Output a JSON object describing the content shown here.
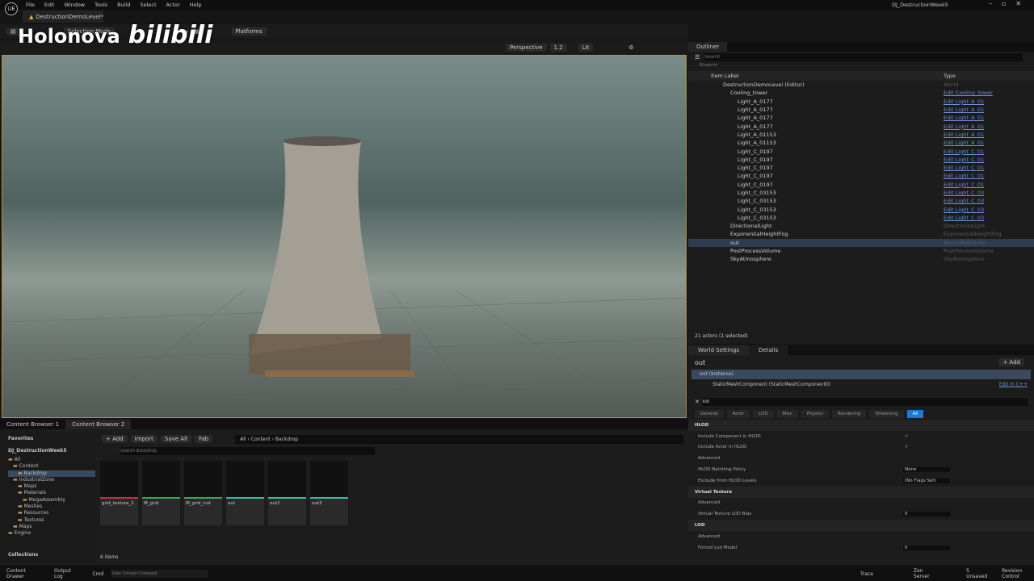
{
  "app": {
    "logo": "UE",
    "window_title": "DJ_DestructionWeek5",
    "menu": [
      "File",
      "Edit",
      "Window",
      "Tools",
      "Build",
      "Select",
      "Actor",
      "Help"
    ],
    "level_tab": "DestructionDemoLevel*"
  },
  "watermark": {
    "text": "Holonova",
    "brand": "bilibili"
  },
  "toolbar": {
    "mode": "Selection Mode",
    "platforms": "Platforms"
  },
  "viewport_toolbar": {
    "perspective": "Perspective",
    "camera_speed": "1.2",
    "view_mode": "Lit"
  },
  "outliner": {
    "tab": "Outliner",
    "search_placeholder": "Search",
    "filter_chip": "Blueprint",
    "col_label": "Item Label",
    "col_type": "Type",
    "items": [
      {
        "label": "DestructionDemoLevel (Editor)",
        "type": "World",
        "indent": 1,
        "link": false
      },
      {
        "label": "Cooling_tower",
        "type": "Edit Cooling_tower",
        "indent": 2,
        "link": true
      },
      {
        "label": "Light_A_0177",
        "type": "Edit Light_A_01",
        "indent": 3,
        "link": true
      },
      {
        "label": "Light_A_0177",
        "type": "Edit Light_A_01",
        "indent": 3,
        "link": true
      },
      {
        "label": "Light_A_0177",
        "type": "Edit Light_A_01",
        "indent": 3,
        "link": true
      },
      {
        "label": "Light_A_0177",
        "type": "Edit Light_A_01",
        "indent": 3,
        "link": true
      },
      {
        "label": "Light_A_01153",
        "type": "Edit Light_A_01",
        "indent": 3,
        "link": true
      },
      {
        "label": "Light_A_01153",
        "type": "Edit Light_A_01",
        "indent": 3,
        "link": true
      },
      {
        "label": "Light_C_0197",
        "type": "Edit Light_C_01",
        "indent": 3,
        "link": true
      },
      {
        "label": "Light_C_0197",
        "type": "Edit Light_C_01",
        "indent": 3,
        "link": true
      },
      {
        "label": "Light_C_0197",
        "type": "Edit Light_C_01",
        "indent": 3,
        "link": true
      },
      {
        "label": "Light_C_0197",
        "type": "Edit Light_C_01",
        "indent": 3,
        "link": true
      },
      {
        "label": "Light_C_0197",
        "type": "Edit Light_C_01",
        "indent": 3,
        "link": true
      },
      {
        "label": "Light_C_03153",
        "type": "Edit Light_C_03",
        "indent": 3,
        "link": true
      },
      {
        "label": "Light_C_03153",
        "type": "Edit Light_C_03",
        "indent": 3,
        "link": true
      },
      {
        "label": "Light_C_03153",
        "type": "Edit Light_C_03",
        "indent": 3,
        "link": true
      },
      {
        "label": "Light_C_03153",
        "type": "Edit Light_C_03",
        "indent": 3,
        "link": true
      },
      {
        "label": "DirectionalLight",
        "type": "DirectionalLight",
        "indent": 2,
        "link": false
      },
      {
        "label": "ExponentialHeightFog",
        "type": "ExponentialHeightFog",
        "indent": 2,
        "link": false
      },
      {
        "label": "out",
        "type": "StaticMeshActor",
        "indent": 2,
        "link": false,
        "selected": true
      },
      {
        "label": "PostProcessVolume",
        "type": "PostProcessVolume",
        "indent": 2,
        "link": false
      },
      {
        "label": "SkyAtmosphere",
        "type": "SkyAtmosphere",
        "indent": 2,
        "link": false
      }
    ],
    "count": "21 actors (1 selected)"
  },
  "details": {
    "tabs": [
      "World Settings",
      "Details"
    ],
    "actor": "out",
    "add": "+ Add",
    "instance": "out (Instance)",
    "component": "StaticMeshComponent (StaticMeshComponent0)",
    "edit_cpp": "Edit in C++",
    "search": "lod",
    "filters": [
      "General",
      "Actor",
      "LOD",
      "Misc",
      "Physics",
      "Rendering",
      "Streaming",
      "All"
    ],
    "props": [
      {
        "label": "HLOD",
        "kind": "section"
      },
      {
        "label": "Include Component in HLOD",
        "kind": "check",
        "value": "✓"
      },
      {
        "label": "Include Actor in HLOD",
        "kind": "check",
        "value": "✓"
      },
      {
        "label": "Advanced",
        "kind": "sub"
      },
      {
        "label": "HLOD Batching Policy",
        "kind": "select",
        "value": "None"
      },
      {
        "label": "Exclude from HLOD Levels",
        "kind": "select",
        "value": "(No Flags Set)"
      },
      {
        "label": "Virtual Texture",
        "kind": "section"
      },
      {
        "label": "Advanced",
        "kind": "sub"
      },
      {
        "label": "Virtual Texture LOD Bias",
        "kind": "num",
        "value": "0"
      },
      {
        "label": "LOD",
        "kind": "section"
      },
      {
        "label": "Advanced",
        "kind": "sub"
      },
      {
        "label": "Forced Lod Model",
        "kind": "num",
        "value": "0"
      }
    ]
  },
  "content_browser": {
    "tabs": [
      "Content Browser 1",
      "Content Browser 2"
    ],
    "add": "+ Add",
    "import": "Import",
    "save_all": "Save All",
    "fab": "Fab",
    "path": [
      "All",
      "Content",
      "Backdrop"
    ],
    "search_placeholder": "Search Backdrop",
    "favorites": "Favorites",
    "project": "DJ_DestructionWeek5",
    "collections": "Collections",
    "item_count": "6 items",
    "tree": [
      "All",
      "Content",
      "Backdrop",
      "IndustrialZone",
      "Maps",
      "Materials",
      "MegaAssembly",
      "Meshes",
      "Resources",
      "Textures",
      "Maps",
      "Engine"
    ],
    "assets": [
      {
        "name": "grid_texture_2",
        "color": "#c0304a"
      },
      {
        "name": "M_grid",
        "color": "#3aa84a"
      },
      {
        "name": "M_grid_inst",
        "color": "#3aa84a"
      },
      {
        "name": "out",
        "color": "#2fc0a0"
      },
      {
        "name": "out2",
        "color": "#2fc0a0"
      },
      {
        "name": "out3",
        "color": "#2fc0a0"
      }
    ]
  },
  "statusbar": {
    "content_drawer": "Content Drawer",
    "output_log": "Output Log",
    "cmd": "Cmd",
    "console_placeholder": "Enter Console Command",
    "trace": "Trace",
    "zen": "Zen Server",
    "unsaved": "5 Unsaved",
    "revision": "Revision Control"
  }
}
